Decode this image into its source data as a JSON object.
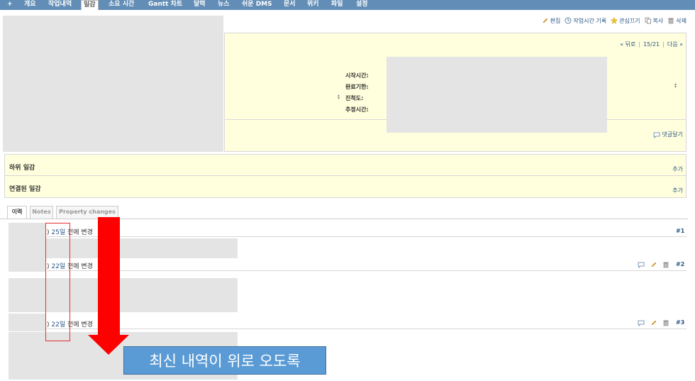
{
  "topnav": {
    "plus": "+",
    "tabs": [
      "개요",
      "작업내역",
      "일감",
      "소요 시간",
      "Gantt 차트",
      "달력",
      "뉴스",
      "쉬운 DMS",
      "문서",
      "위키",
      "파일",
      "설정"
    ],
    "selected_index": 2
  },
  "contextual": {
    "edit": "편집",
    "log_time": "작업시간 기록",
    "unwatch": "관심끄기",
    "copy": "복사",
    "delete": "삭제"
  },
  "pager": {
    "prev": "« 뒤로",
    "position": "15/21",
    "next": "다음 »"
  },
  "attributes": {
    "start_date": "시작시간:",
    "due_date": "완료기한:",
    "done_ratio": "진척도:",
    "estimated": "추정시간:"
  },
  "reply": "댓글달기",
  "subtasks": {
    "title": "하위 일감",
    "add": "추가"
  },
  "relations": {
    "title": "연결된 일감",
    "add": "추가"
  },
  "history_tabs": [
    "이력",
    "Notes",
    "Property changes"
  ],
  "journals": [
    {
      "paren": ")",
      "ago_link": "25일",
      "rest": " 전에 변경",
      "num": "#1"
    },
    {
      "paren": ")",
      "ago_link": "22일",
      "rest": " 전에 변경",
      "num": "#2"
    },
    {
      "paren": ")",
      "ago_link": "22일",
      "rest": " 전에 변경",
      "num": "#3"
    }
  ],
  "annotation": {
    "callout": "최신 내역이 위로 오도록",
    "arrow_color": "#ff0000",
    "callout_color": "#5b9bd5"
  },
  "colors": {
    "nav": "#628DB6",
    "issue_bg": "#ffffdd",
    "link": "#2A5685"
  }
}
